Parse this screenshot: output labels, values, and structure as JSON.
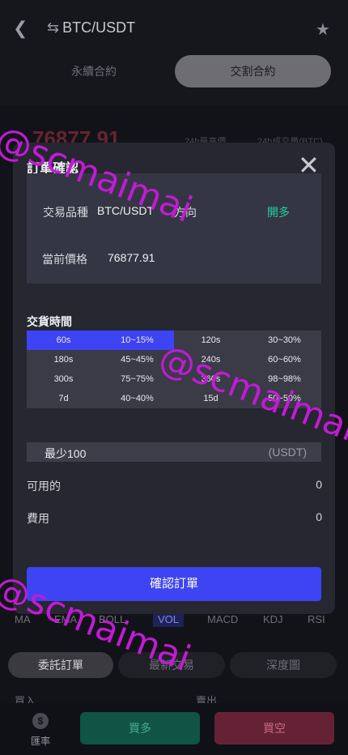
{
  "header": {
    "back_icon": "back-arrow-icon",
    "pair": "BTC/USDT",
    "swap_icon": "swap-icon",
    "star_icon": "star-icon"
  },
  "market_tabs": [
    {
      "label": "永續合約"
    },
    {
      "label": "交割合約"
    }
  ],
  "background": {
    "price": "76877.91",
    "stat_high": "24h最高價",
    "stat_vol": "24h成交量(BTC)",
    "indicators": [
      "MA",
      "EMA",
      "BOLL",
      "VOL",
      "MACD",
      "KDJ",
      "RSI"
    ],
    "bottom_tabs": [
      "委託訂單",
      "最新交易",
      "深度圖"
    ],
    "orderbook_buy": "買入",
    "orderbook_sell": "賣出"
  },
  "bottom_bar": {
    "rate_label": "匯率",
    "rate_icon_glyph": "$",
    "buy_label": "買多",
    "sell_label": "買空"
  },
  "modal": {
    "title": "訂單確認",
    "close_icon": "close-icon",
    "product_label": "交易品種",
    "product_value": "BTC/USDT",
    "direction_label": "方向",
    "direction_value": "開多",
    "current_price_label": "當前價格",
    "current_price_value": "76877.91",
    "delivery_title": "交貨時間",
    "delivery_options": [
      {
        "time": "60s",
        "rate": "10~15%",
        "selected": true
      },
      {
        "time": "120s",
        "rate": "30~30%",
        "selected": false
      },
      {
        "time": "180s",
        "rate": "45~45%",
        "selected": false
      },
      {
        "time": "240s",
        "rate": "60~60%",
        "selected": false
      },
      {
        "time": "300s",
        "rate": "75~75%",
        "selected": false
      },
      {
        "time": "360s",
        "rate": "98~98%",
        "selected": false
      },
      {
        "time": "7d",
        "rate": "40~40%",
        "selected": false
      },
      {
        "time": "15d",
        "rate": "50~50%",
        "selected": false
      }
    ],
    "min_label": "最少100",
    "min_unit": "(USDT)",
    "available_label": "可用的",
    "available_value": "0",
    "fee_label": "費用",
    "fee_value": "0",
    "confirm_label": "確認訂單"
  },
  "watermark": {
    "text": "@scmaimai",
    "color": "#c31ad6"
  }
}
